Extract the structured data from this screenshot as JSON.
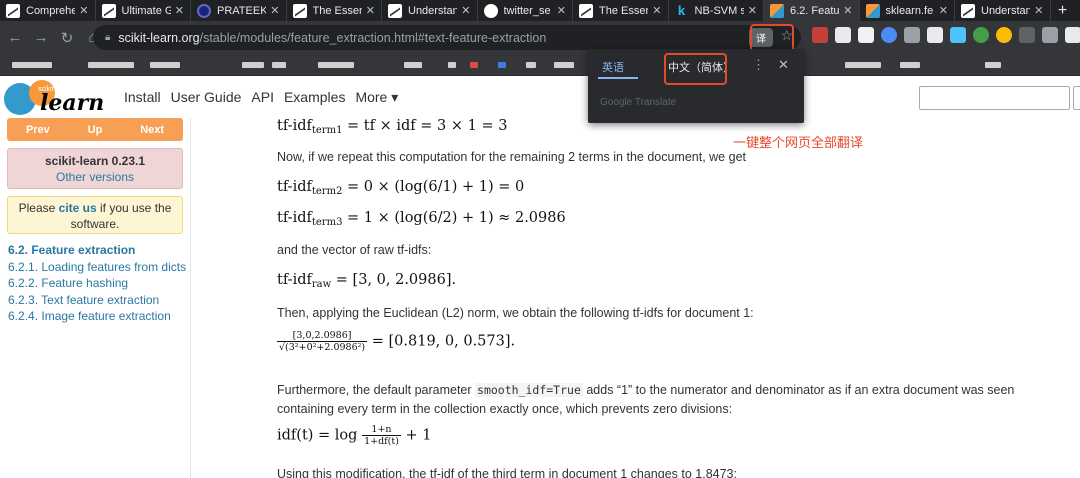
{
  "tabs": [
    {
      "title": "Comprehe",
      "favicon": "chart-favicon",
      "active": false
    },
    {
      "title": "Ultimate G",
      "favicon": "chart-favicon",
      "active": false
    },
    {
      "title": "PRATEEK",
      "favicon": "profile-favicon",
      "active": false
    },
    {
      "title": "The Essen",
      "favicon": "chart-favicon",
      "active": false
    },
    {
      "title": "Understan",
      "favicon": "chart-favicon",
      "active": false
    },
    {
      "title": "twitter_se",
      "favicon": "github-favicon",
      "active": false
    },
    {
      "title": "The Essen",
      "favicon": "chart-favicon",
      "active": false
    },
    {
      "title": "NB-SVM s",
      "favicon": "kaggle-favicon",
      "active": false
    },
    {
      "title": "6.2. Featu",
      "favicon": "sklearn-favicon",
      "active": true
    },
    {
      "title": "sklearn.fe",
      "favicon": "sklearn-favicon",
      "active": false
    },
    {
      "title": "Understan",
      "favicon": "chart-favicon",
      "active": false
    }
  ],
  "address": {
    "host": "scikit-learn.org",
    "path": "/stable/modules/feature_extraction.html#text-feature-extraction"
  },
  "translate_popup": {
    "source_lang": "英语",
    "target_lang": "中文（简体）",
    "footer": "Google Translate"
  },
  "annotation": "一键整个网页全部翻译",
  "site": {
    "logo_small": "scikit",
    "logo_big": "learn",
    "nav": [
      "Install",
      "User Guide",
      "API",
      "Examples",
      "More ▾"
    ],
    "prev": "Prev",
    "up": "Up",
    "next": "Next",
    "version_name": "scikit-learn 0.23.1",
    "version_link": "Other versions",
    "cite_pre": "Please ",
    "cite_link": "cite us",
    "cite_post": " if you use the software.",
    "toc": [
      "6.2. Feature extraction",
      "6.2.1. Loading features from dicts",
      "6.2.2. Feature hashing",
      "6.2.3. Text feature extraction",
      "6.2.4. Image feature extraction"
    ]
  },
  "content": {
    "eq1": "tf-idf",
    "eq1_sub": "term1",
    "eq1_rhs": " = tf × idf = 3 × 1 = 3",
    "p1": "Now, if we repeat this computation for the remaining 2 terms in the document, we get",
    "eq2": "tf-idf",
    "eq2_sub": "term2",
    "eq2_rhs": " = 0 × (log(6/1) + 1) = 0",
    "eq3": "tf-idf",
    "eq3_sub": "term3",
    "eq3_rhs": " = 1 × (log(6/2) + 1) ≈ 2.0986",
    "p2": "and the vector of raw tf-idfs:",
    "eq4": "tf-idf",
    "eq4_sub": "raw",
    "eq4_rhs": " = [3, 0, 2.0986].",
    "p3": "Then, applying the Euclidean (L2) norm, we obtain the following tf-idfs for document 1:",
    "eq5_num": "[3,0,2.0986]",
    "eq5_den": "√(3²+0²+2.0986²)",
    "eq5_rhs": " = [0.819, 0, 0.573].",
    "p4_pre": "Furthermore, the default parameter ",
    "p4_code": "smooth_idf=True",
    "p4_post": " adds “1” to the numerator and denominator as if an extra document was seen containing every term in the collection exactly once, which prevents zero divisions:",
    "eq6_lhs": "idf(t) = log ",
    "eq6_num": "1+n",
    "eq6_den": "1+df(t)",
    "eq6_rhs": " + 1",
    "p5": "Using this modification, the tf-idf of the third term in document 1 changes to 1.8473:"
  }
}
